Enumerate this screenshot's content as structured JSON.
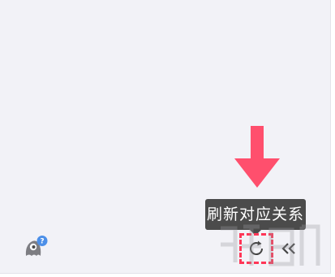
{
  "tooltip": {
    "label": "刷新对应关系"
  },
  "icons": {
    "refresh": "refresh-icon",
    "collapse": "double-chevron-left-icon",
    "help": "help-widget-icon",
    "arrow": "down-arrow-icon",
    "watermark": "watermark-logo-icon"
  },
  "colors": {
    "panel_background": "#f2f2f7",
    "tooltip_background": "#4b4b4b",
    "highlight": "#ff3657",
    "arrow": "#ff4f6d",
    "help_badge": "#4c8fe8"
  }
}
